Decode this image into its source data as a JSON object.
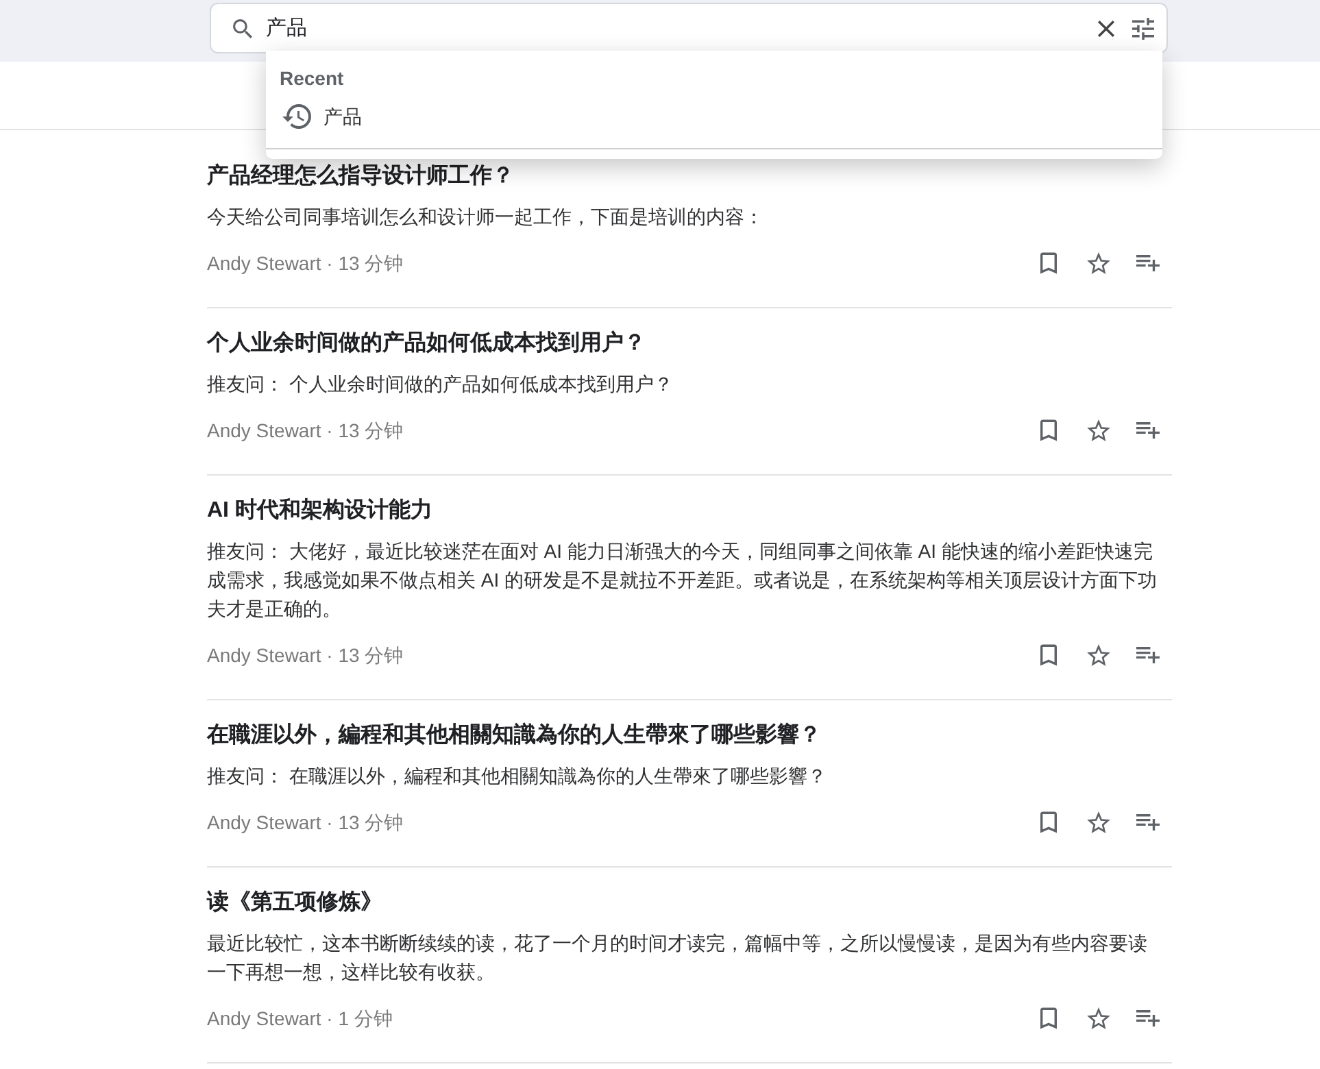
{
  "search": {
    "value": "产品"
  },
  "recent": {
    "heading": "Recent",
    "items": [
      {
        "text": "产品"
      }
    ]
  },
  "articles": [
    {
      "title": "产品经理怎么指导设计师工作？",
      "summary": "今天给公司同事培训怎么和设计师一起工作，下面是培训的内容：",
      "byline": "Andy Stewart · 13 分钟"
    },
    {
      "title": "个人业余时间做的产品如何低成本找到用户？",
      "summary": "推友问： 个人业余时间做的产品如何低成本找到用户？",
      "byline": "Andy Stewart · 13 分钟"
    },
    {
      "title": "AI 时代和架构设计能力",
      "summary": "推友问： 大佬好，最近比较迷茫在面对 AI 能力日渐强大的今天，同组同事之间依靠 AI 能快速的缩小差距快速完成需求，我感觉如果不做点相关 AI 的研发是不是就拉不开差距。或者说是，在系统架构等相关顶层设计方面下功夫才是正确的。",
      "byline": "Andy Stewart · 13 分钟"
    },
    {
      "title": "在職涯以外，編程和其他相關知識為你的人生帶來了哪些影響？",
      "summary": "推友问： 在職涯以外，編程和其他相關知識為你的人生帶來了哪些影響？",
      "byline": "Andy Stewart · 13 分钟"
    },
    {
      "title": "读《第五项修炼》",
      "summary": "最近比较忙，这本书断断续续的读，花了一个月的时间才读完，篇幅中等，之所以慢慢读，是因为有些内容要读一下再想一想，这样比较有收获。",
      "byline": "Andy Stewart · 1 分钟"
    }
  ]
}
